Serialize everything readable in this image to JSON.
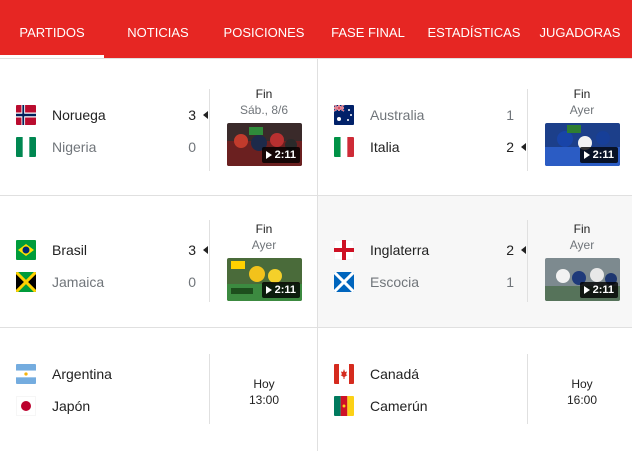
{
  "tabs": [
    {
      "label": "PARTIDOS",
      "active": true
    },
    {
      "label": "NOTICIAS"
    },
    {
      "label": "POSICIONES"
    },
    {
      "label": "FASE FINAL"
    },
    {
      "label": "ESTADÍSTICAS"
    },
    {
      "label": "JUGADORAS"
    }
  ],
  "matches": [
    {
      "home": {
        "name": "Noruega",
        "score": "3",
        "flag": "norway"
      },
      "away": {
        "name": "Nigeria",
        "score": "0",
        "flag": "nigeria"
      },
      "status": "Fin",
      "date": "Sáb., 8/6",
      "duration": "2:11"
    },
    {
      "home": {
        "name": "Australia",
        "score": "1",
        "flag": "australia"
      },
      "away": {
        "name": "Italia",
        "score": "2",
        "flag": "italy"
      },
      "status": "Fin",
      "date": "Ayer",
      "duration": "2:11"
    },
    {
      "home": {
        "name": "Brasil",
        "score": "3",
        "flag": "brazil"
      },
      "away": {
        "name": "Jamaica",
        "score": "0",
        "flag": "jamaica"
      },
      "status": "Fin",
      "date": "Ayer",
      "duration": "2:11"
    },
    {
      "home": {
        "name": "Inglaterra",
        "score": "2",
        "flag": "england"
      },
      "away": {
        "name": "Escocia",
        "score": "1",
        "flag": "scotland"
      },
      "status": "Fin",
      "date": "Ayer",
      "duration": "2:11"
    },
    {
      "home": {
        "name": "Argentina",
        "flag": "argentina"
      },
      "away": {
        "name": "Japón",
        "flag": "japan"
      },
      "day": "Hoy",
      "time": "13:00"
    },
    {
      "home": {
        "name": "Canadá",
        "flag": "canada"
      },
      "away": {
        "name": "Camerún",
        "flag": "cameroon"
      },
      "day": "Hoy",
      "time": "16:00"
    }
  ],
  "colors": {
    "brand_red": "#e62623",
    "muted": "#70757a"
  }
}
